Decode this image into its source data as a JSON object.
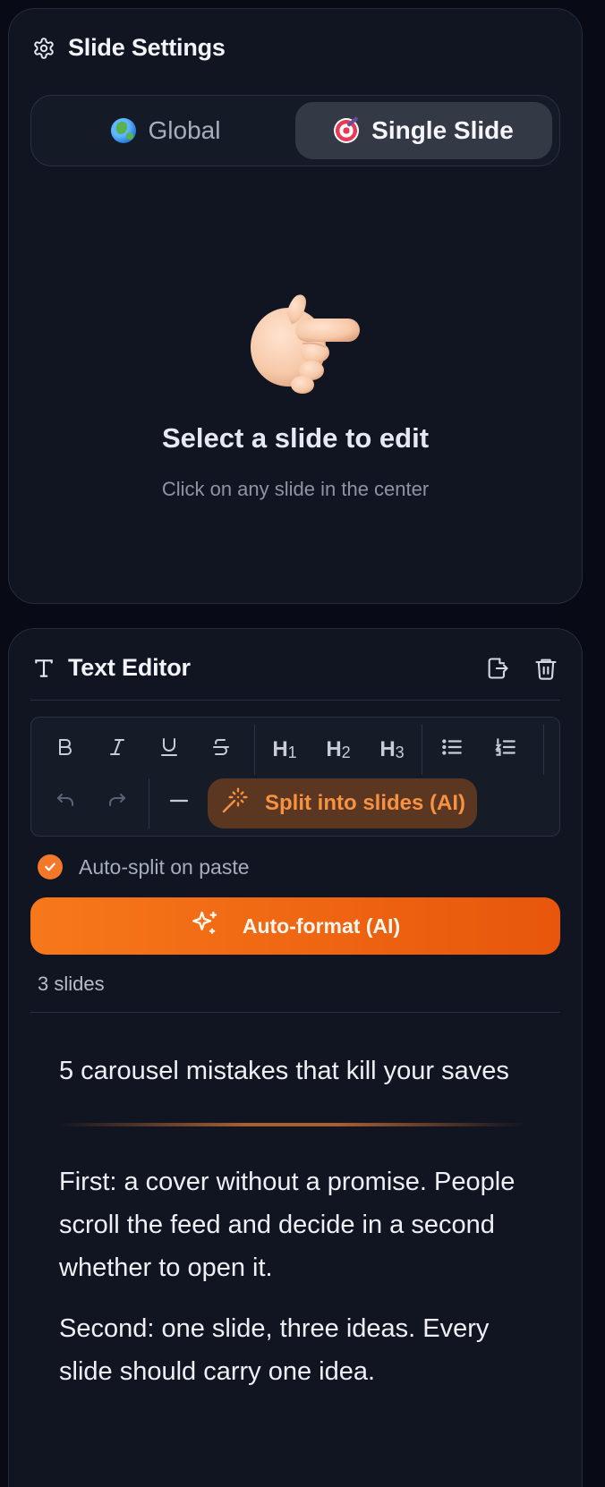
{
  "settings": {
    "title": "Slide Settings",
    "icon": "gear-icon",
    "tabs": [
      {
        "label": "Global",
        "icon": "globe-emoji",
        "active": false
      },
      {
        "label": "Single Slide",
        "icon": "target-emoji",
        "active": true
      }
    ],
    "empty": {
      "icon": "pointing-hand-emoji",
      "title": "Select a slide to edit",
      "subtitle": "Click on any slide in the center"
    }
  },
  "editor": {
    "title": "Text Editor",
    "header_icons": [
      "export-icon",
      "trash-icon"
    ],
    "toolbar": {
      "format": [
        "bold-icon",
        "italic-icon",
        "underline-icon",
        "strikethrough-icon"
      ],
      "headings": [
        {
          "main": "H",
          "sub": "1"
        },
        {
          "main": "H",
          "sub": "2"
        },
        {
          "main": "H",
          "sub": "3"
        }
      ],
      "lists": [
        "bullet-list-icon",
        "numbered-list-icon"
      ],
      "history": [
        "undo-icon",
        "redo-icon"
      ],
      "rule": "horizontal-rule-icon",
      "split_label": "Split into slides (AI)"
    },
    "auto_split": {
      "label": "Auto-split on paste",
      "checked": true
    },
    "autoformat_label": "Auto-format (AI)",
    "slide_count": "3 slides",
    "content": {
      "title": "5 carousel mistakes that kill your saves",
      "paragraphs": [
        "First: a cover without a promise. People scroll the feed and decide in a second whether to open it.",
        "Second: one slide, three ideas. Every slide should carry one idea."
      ]
    },
    "colors": {
      "accent": "#f4782a",
      "panel": "#111522",
      "background": "#080b16"
    }
  }
}
